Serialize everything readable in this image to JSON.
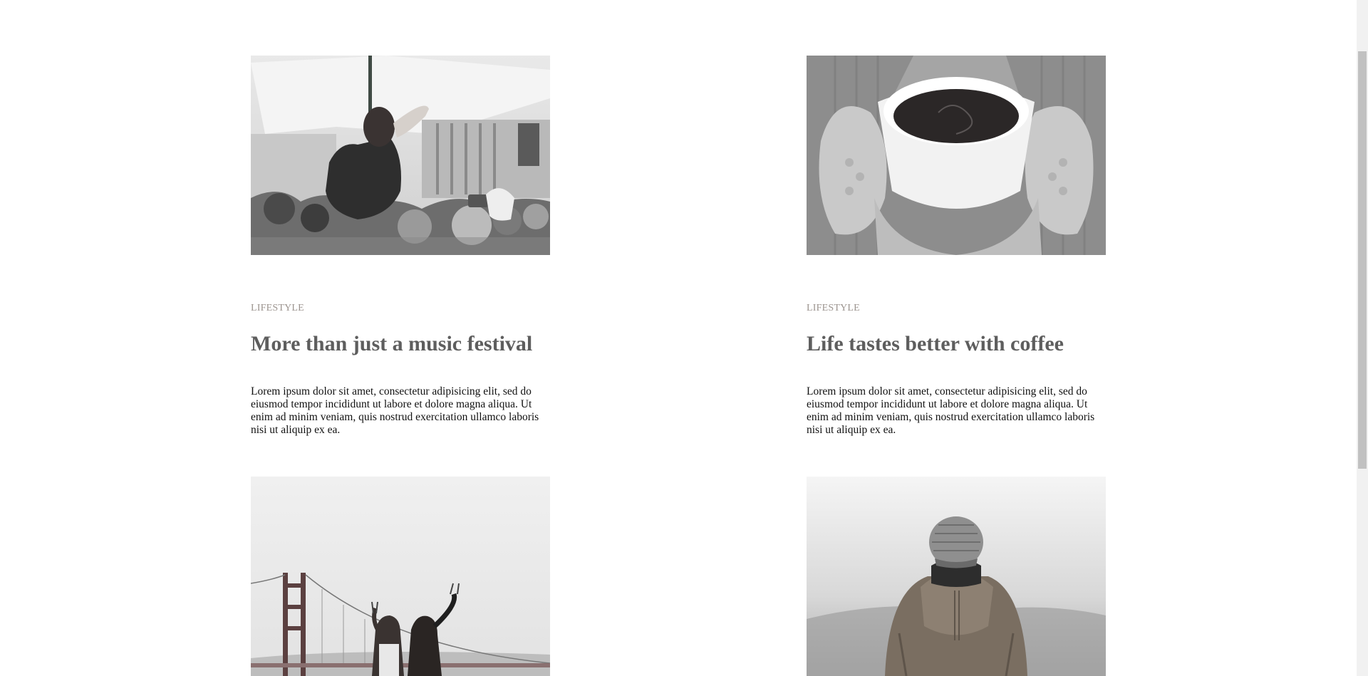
{
  "posts": [
    {
      "category": "LIFESTYLE",
      "title": "More than just a music festival",
      "excerpt": "Lorem ipsum dolor sit amet, consectetur adipisicing elit, sed do eiusmod tempor incididunt ut labore et dolore magna aliqua. Ut enim ad minim veniam, quis nostrud exercitation ullamco laboris nisi ut aliquip ex ea.",
      "image": "festival-crowd-photo"
    },
    {
      "category": "LIFESTYLE",
      "title": "Life tastes better with coffee",
      "excerpt": "Lorem ipsum dolor sit amet, consectetur adipisicing elit, sed do eiusmod tempor incididunt ut labore et dolore magna aliqua. Ut enim ad minim veniam, quis nostrud exercitation ullamco laboris nisi ut aliquip ex ea.",
      "image": "coffee-mug-mittens-photo"
    },
    {
      "image": "golden-gate-bridge-photo"
    },
    {
      "image": "person-beanie-photo"
    }
  ]
}
